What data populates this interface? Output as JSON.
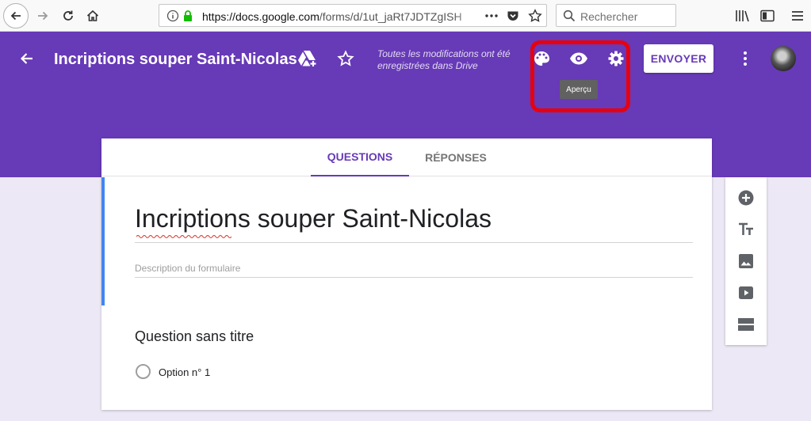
{
  "browser": {
    "url_host": "https://docs.google.com",
    "url_path": "/forms/d/1ut_jaRt7JDTZgISH",
    "search_placeholder": "Rechercher"
  },
  "header": {
    "form_title": "Incriptions souper Saint-Nicolas",
    "saved_note": "Toutes les modifications ont été enregistrées dans Drive",
    "send_label": "ENVOYER",
    "tooltip": "Aperçu",
    "accent_color": "#673ab7"
  },
  "tabs": [
    {
      "label": "QUESTIONS",
      "active": true
    },
    {
      "label": "RÉPONSES",
      "active": false
    }
  ],
  "form": {
    "title": "Incriptions souper Saint-Nicolas",
    "description_placeholder": "Description du formulaire",
    "question_title": "Question sans titre",
    "option_label": "Option n° 1"
  },
  "icons": {
    "toolbar": [
      "add-circle-icon",
      "title-text-icon",
      "image-icon",
      "video-icon",
      "section-icon"
    ],
    "header": [
      "palette-icon",
      "eye-icon",
      "gear-icon",
      "more-vertical-icon"
    ]
  }
}
